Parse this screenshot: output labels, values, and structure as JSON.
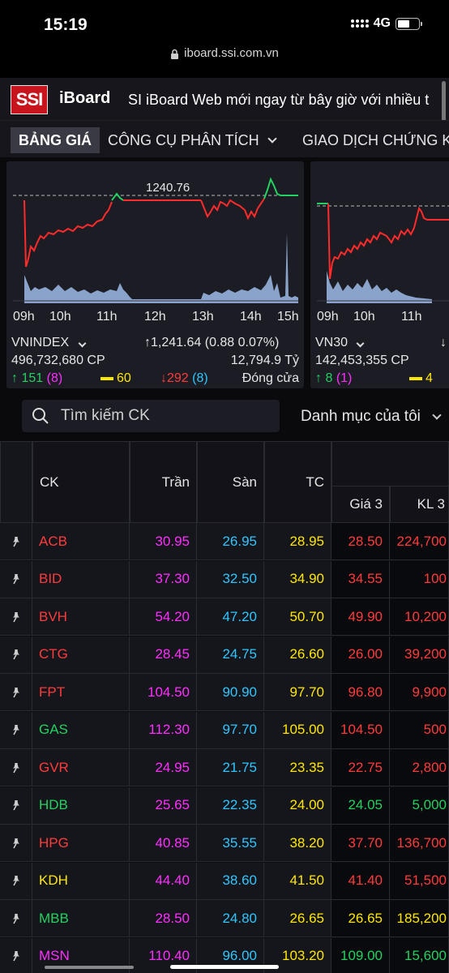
{
  "status_bar": {
    "time": "15:19",
    "network": "4G"
  },
  "browser": {
    "url": "iboard.ssi.com.vn"
  },
  "header": {
    "logo": "SSI",
    "brand": "iBoard",
    "marquee": "SI iBoard Web mới ngay từ bây giờ với nhiều t"
  },
  "nav": {
    "tabs": [
      {
        "label": "BẢNG GIÁ",
        "active": true
      },
      {
        "label": "CÔNG CỤ PHÂN TÍCH",
        "dropdown": true
      },
      {
        "label": "GIAO DỊCH CHỨNG K"
      }
    ]
  },
  "indices": [
    {
      "name": "VNINDEX",
      "value": "1,241.64",
      "change": "(0.88 0.07%)",
      "volume": "496,732,680 CP",
      "turnover": "12,794.9 Tỷ",
      "advances": "151",
      "ceiling": "(8)",
      "unchanged": "60",
      "declines": "292",
      "floor": "(8)",
      "status": "Đóng cửa",
      "reference_label": "1240.76",
      "time_labels": [
        "09h",
        "10h",
        "11h",
        "12h",
        "13h",
        "14h",
        "15h"
      ]
    },
    {
      "name": "VN30",
      "volume": "142,453,355 CP",
      "advances": "8",
      "ceiling": "(1)",
      "unchanged": "4",
      "time_labels": [
        "09h",
        "10h",
        "11h"
      ]
    }
  ],
  "colors": {
    "up": "#23d160",
    "down": "#ff3b3b",
    "ref": "#ffe600",
    "ceiling": "#ff2eff",
    "floor": "#2fc6ff",
    "volume": "#8fb4e6"
  },
  "search": {
    "placeholder": "Tìm kiếm CK",
    "watchlist_label": "Danh mục của tôi"
  },
  "table": {
    "headers": {
      "ck": "CK",
      "tran": "Trần",
      "san": "Sàn",
      "tc": "TC",
      "gia3": "Giá 3",
      "kl3": "KL 3"
    },
    "rows": [
      {
        "ck": "ACB",
        "tran": "30.95",
        "san": "26.95",
        "tc": "28.95",
        "gia3": "28.50",
        "kl3": "224,700",
        "color": "#ff3b3b"
      },
      {
        "ck": "BID",
        "tran": "37.30",
        "san": "32.50",
        "tc": "34.90",
        "gia3": "34.55",
        "kl3": "100",
        "color": "#ff3b3b"
      },
      {
        "ck": "BVH",
        "tran": "54.20",
        "san": "47.20",
        "tc": "50.70",
        "gia3": "49.90",
        "kl3": "10,200",
        "color": "#ff3b3b"
      },
      {
        "ck": "CTG",
        "tran": "28.45",
        "san": "24.75",
        "tc": "26.60",
        "gia3": "26.00",
        "kl3": "39,200",
        "color": "#ff3b3b"
      },
      {
        "ck": "FPT",
        "tran": "104.50",
        "san": "90.90",
        "tc": "97.70",
        "gia3": "96.80",
        "kl3": "9,900",
        "color": "#ff3b3b"
      },
      {
        "ck": "GAS",
        "tran": "112.30",
        "san": "97.70",
        "tc": "105.00",
        "gia3": "104.50",
        "kl3": "500",
        "color": "#23d160",
        "g3color": "#ff3b3b"
      },
      {
        "ck": "GVR",
        "tran": "24.95",
        "san": "21.75",
        "tc": "23.35",
        "gia3": "22.75",
        "kl3": "2,800",
        "color": "#ff3b3b"
      },
      {
        "ck": "HDB",
        "tran": "25.65",
        "san": "22.35",
        "tc": "24.00",
        "gia3": "24.05",
        "kl3": "5,000",
        "color": "#23d160"
      },
      {
        "ck": "HPG",
        "tran": "40.85",
        "san": "35.55",
        "tc": "38.20",
        "gia3": "37.70",
        "kl3": "136,700",
        "color": "#ff3b3b"
      },
      {
        "ck": "KDH",
        "tran": "44.40",
        "san": "38.60",
        "tc": "41.50",
        "gia3": "41.40",
        "kl3": "51,500",
        "color": "#ffe600",
        "g3color": "#ff3b3b"
      },
      {
        "ck": "MBB",
        "tran": "28.50",
        "san": "24.80",
        "tc": "26.65",
        "gia3": "26.65",
        "kl3": "185,200",
        "color": "#23d160",
        "g3color": "#ffe600"
      },
      {
        "ck": "MSN",
        "tran": "110.40",
        "san": "96.00",
        "tc": "103.20",
        "gia3": "109.00",
        "kl3": "15,600",
        "color": "#ff2eff",
        "g3color": "#23d160"
      }
    ]
  }
}
